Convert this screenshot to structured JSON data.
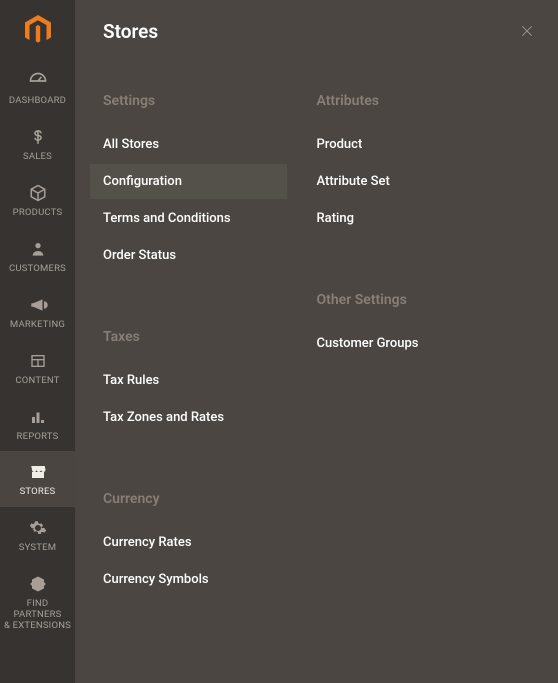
{
  "panel_title": "Stores",
  "sidebar": {
    "items": [
      {
        "id": "dashboard",
        "label": "DASHBOARD"
      },
      {
        "id": "sales",
        "label": "SALES"
      },
      {
        "id": "products",
        "label": "PRODUCTS"
      },
      {
        "id": "customers",
        "label": "CUSTOMERS"
      },
      {
        "id": "marketing",
        "label": "MARKETING"
      },
      {
        "id": "content",
        "label": "CONTENT"
      },
      {
        "id": "reports",
        "label": "REPORTS"
      },
      {
        "id": "stores",
        "label": "STORES"
      },
      {
        "id": "system",
        "label": "SYSTEM"
      },
      {
        "id": "find_partners",
        "label": "FIND PARTNERS\n& EXTENSIONS"
      }
    ],
    "active": "stores"
  },
  "columns": {
    "left": {
      "groups": [
        {
          "heading": "Settings",
          "items": [
            {
              "label": "All Stores",
              "selected": false
            },
            {
              "label": "Configuration",
              "selected": true
            },
            {
              "label": "Terms and Conditions",
              "selected": false
            },
            {
              "label": "Order Status",
              "selected": false
            }
          ]
        },
        {
          "heading": "Taxes",
          "items": [
            {
              "label": "Tax Rules",
              "selected": false
            },
            {
              "label": "Tax Zones and Rates",
              "selected": false
            }
          ]
        },
        {
          "heading": "Currency",
          "items": [
            {
              "label": "Currency Rates",
              "selected": false
            },
            {
              "label": "Currency Symbols",
              "selected": false
            }
          ]
        }
      ]
    },
    "right": {
      "groups": [
        {
          "heading": "Attributes",
          "items": [
            {
              "label": "Product",
              "selected": false
            },
            {
              "label": "Attribute Set",
              "selected": false
            },
            {
              "label": "Rating",
              "selected": false
            }
          ]
        },
        {
          "heading": "Other Settings",
          "items": [
            {
              "label": "Customer Groups",
              "selected": false
            }
          ]
        }
      ]
    }
  }
}
